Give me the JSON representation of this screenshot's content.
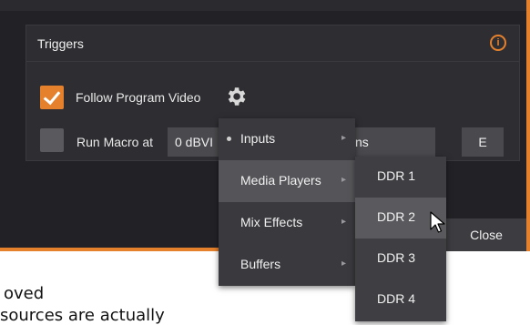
{
  "panel": {
    "title": "Triggers",
    "info_icon": "info-icon"
  },
  "follow_program": {
    "label": "Follow Program Video",
    "checked": true,
    "gear_icon": "gear-icon"
  },
  "run_macro": {
    "label": "Run Macro at",
    "checked": false,
    "value": "0 dBVI",
    "value_tail": "ns",
    "edit_button": "E"
  },
  "close_button": "Close",
  "menu": {
    "items": [
      {
        "label": "Inputs",
        "bullet": true,
        "arrow": "▸"
      },
      {
        "label": "Media Players",
        "active": true,
        "arrow": "▸"
      },
      {
        "label": "Mix Effects",
        "arrow": "▸"
      },
      {
        "label": "Buffers",
        "arrow": "▸"
      }
    ]
  },
  "submenu": {
    "items": [
      {
        "label": "DDR 1"
      },
      {
        "label": "DDR 2",
        "hover": true
      },
      {
        "label": "DDR 3"
      },
      {
        "label": "DDR 4"
      }
    ]
  },
  "background_text": {
    "line1": "oved",
    "line2": "sources are actually"
  },
  "colors": {
    "accent": "#e5812d",
    "dialog_bg": "#222226",
    "menu_bg": "#3a3a3e"
  }
}
